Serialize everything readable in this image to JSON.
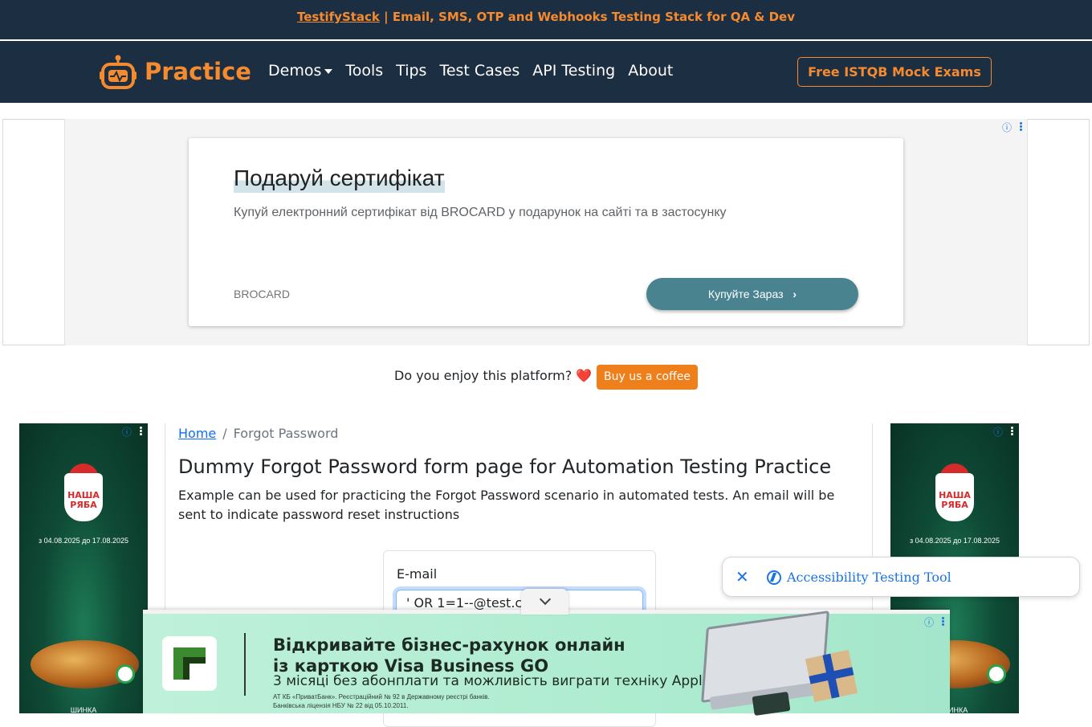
{
  "topbar": {
    "link": "TestifyStack",
    "text": " | Email, SMS, OTP and Webhooks Testing Stack for QA & Dev"
  },
  "navbar": {
    "brand": "Practice",
    "items": [
      "Demos",
      "Tools",
      "Tips",
      "Test Cases",
      "API Testing",
      "About"
    ],
    "cta": "Free ISTQB Mock Exams"
  },
  "ad_top": {
    "title": "Подаруй сертифікат",
    "description": "Купуй електронний сертифікат від BROCARD у подарунок на сайті та в застосунку",
    "brand": "BROCARD",
    "cta": "Купуйте Зараз",
    "info_icon": "ⓘ"
  },
  "support": {
    "text": "Do you enjoy this platform?",
    "heart": "❤️",
    "button": "Buy us a coffee"
  },
  "side_ad": {
    "logo_line1": "НАША",
    "logo_line2": "РЯБА",
    "dates": "з 04.08.2025 до 17.08.2025",
    "bottom": "ШИНКА",
    "info_icon": "ⓘ"
  },
  "breadcrumb": {
    "home": "Home",
    "separator": "/",
    "current": "Forgot Password"
  },
  "page": {
    "title": "Dummy Forgot Password form page for Automation Testing Practice",
    "description": "Example can be used for practicing the Forgot Password scenario in automated tests. An email will be sent to indicate password reset instructions"
  },
  "form": {
    "label": "E-mail",
    "value": "' OR 1=1--@test.com"
  },
  "bottom_ad": {
    "headline1": "Відкривайте бізнес-рахунок онлайн",
    "headline2": "із карткою Visa Business GO",
    "subline": "3 місяці без абонплати та можливість виграти техніку Apple",
    "small1": "АТ КБ «ПриватБанк». Реєстраційний № 92 в Державному реєстрі банків.",
    "small2": "Банківська ліцензія НБУ № 22 від 05.10.2011.",
    "info_icon": "ⓘ"
  },
  "a11y": {
    "close": "✕",
    "label": "Accessibility Testing Tool"
  },
  "colors": {
    "navy": "#1c2e42",
    "orange": "#f58a2f",
    "link": "#0d6efd"
  }
}
